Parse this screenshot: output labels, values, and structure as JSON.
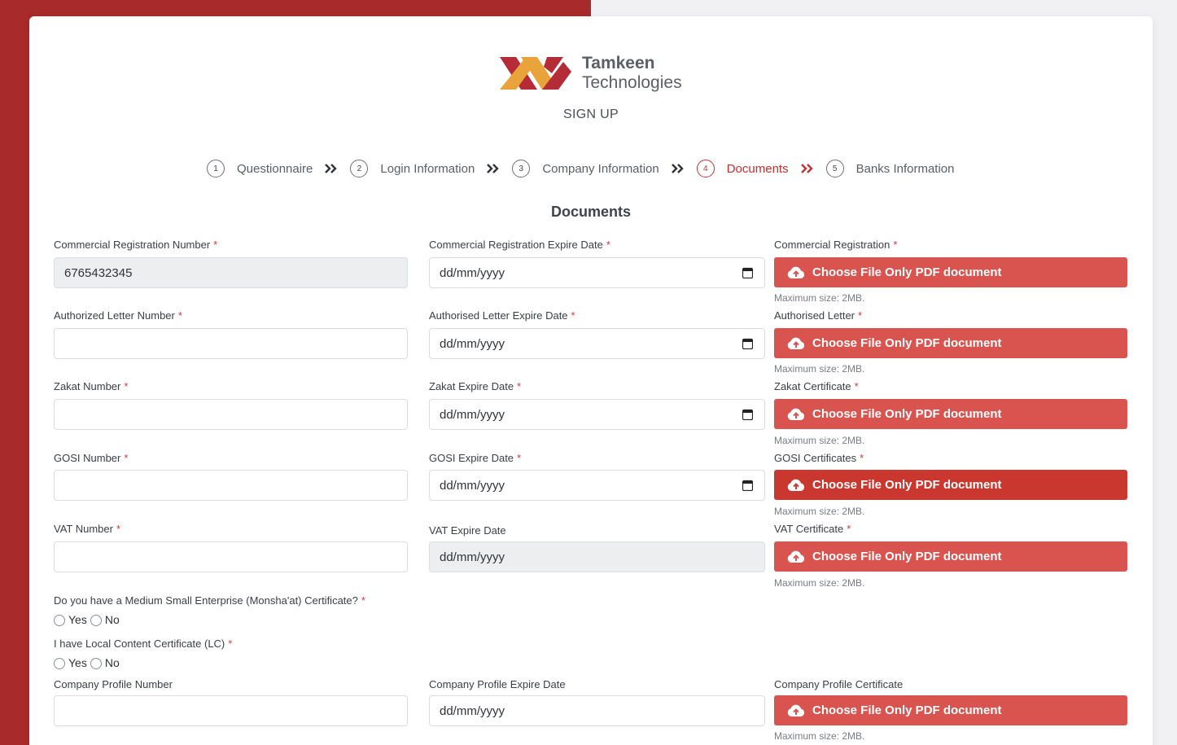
{
  "brand": {
    "name_line1": "Tamkeen",
    "name_line2": "Technologies",
    "color_red": "#b52b36",
    "color_orange": "#e8a33a"
  },
  "header": {
    "title": "SIGN UP"
  },
  "steps": [
    {
      "num": "1",
      "label": "Questionnaire",
      "active": false
    },
    {
      "num": "2",
      "label": "Login Information",
      "active": false
    },
    {
      "num": "3",
      "label": "Company Information",
      "active": false
    },
    {
      "num": "4",
      "label": "Documents",
      "active": true
    },
    {
      "num": "5",
      "label": "Banks Information",
      "active": false
    }
  ],
  "section_title": "Documents",
  "upload_label": "Choose File Only PDF document",
  "upload_hint": "Maximum size: 2MB.",
  "date_placeholder": "dd/mm/yyyy",
  "rows": [
    {
      "number_label": "Commercial Registration Number",
      "number_value": "6765432345",
      "date_label": "Commercial Registration Expire Date",
      "file_label": "Commercial Registration"
    },
    {
      "number_label": "Authorized Letter Number",
      "number_value": "",
      "date_label": "Authorised Letter Expire Date",
      "file_label": "Authorised Letter"
    },
    {
      "number_label": "Zakat Number",
      "number_value": "",
      "date_label": "Zakat Expire Date",
      "file_label": "Zakat Certificate"
    },
    {
      "number_label": "GOSI Number",
      "number_value": "",
      "date_label": "GOSI Expire Date",
      "file_label": "GOSI Certificates"
    },
    {
      "number_label": "VAT Number",
      "number_value": "",
      "date_label": "VAT Expire Date",
      "file_label": "VAT Certificate"
    },
    {
      "number_label": "Company Profile Number",
      "number_value": "",
      "date_label": "Company Profile Expire Date",
      "file_label": "Company Profile Certificate"
    }
  ],
  "questions": [
    {
      "label": "Do you have a Medium Small Enterprise (Monsha'at) Certificate?",
      "yes": "Yes",
      "no": "No"
    },
    {
      "label": "I have Local Content Certificate (LC)",
      "yes": "Yes",
      "no": "No"
    }
  ],
  "required_mark": "*"
}
